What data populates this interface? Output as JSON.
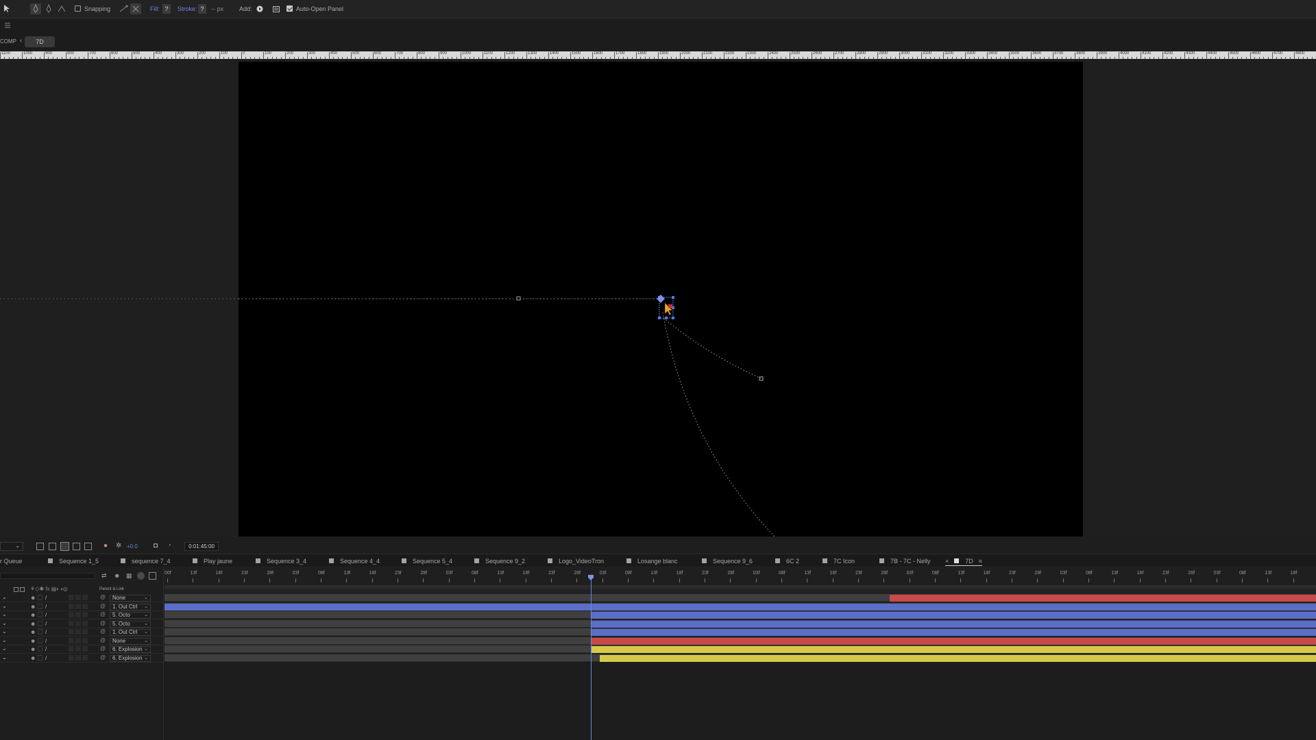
{
  "toolbar": {
    "snapping_label": "Snapping",
    "fill_label": "Fill:",
    "fill_value": "?",
    "stroke_label": "Stroke:",
    "stroke_value": "?",
    "stroke_width": "-- px",
    "add_label": "Add:",
    "auto_open_label": "Auto-Open Panel"
  },
  "comp": {
    "breadcrumb_left": "COMP",
    "active_comp": "7D"
  },
  "ruler_labels": [
    "1100",
    "1000",
    "900",
    "800",
    "700",
    "600",
    "500",
    "400",
    "300",
    "200",
    "100",
    "0",
    "100",
    "200",
    "300",
    "400",
    "500",
    "600",
    "700",
    "800",
    "900",
    "1000",
    "1100",
    "1200",
    "1300",
    "1400",
    "1500",
    "1600",
    "1700",
    "1800",
    "1900",
    "2000",
    "2100",
    "2200",
    "2300",
    "2400",
    "2500",
    "2600",
    "2700",
    "2800",
    "2900",
    "3000",
    "3100",
    "3200",
    "3300",
    "3400",
    "3500",
    "3600",
    "3700",
    "3800",
    "3900",
    "4000",
    "4100",
    "4200",
    "4300",
    "4400",
    "4500",
    "4600",
    "4700",
    "4800"
  ],
  "viewer": {
    "exposure_value": "+0.0",
    "timecode": "0:01:45:00"
  },
  "timeline_tabs": [
    {
      "label": "r Queue",
      "color": ""
    },
    {
      "label": "Sequence 1_5",
      "color": "#a8a29a"
    },
    {
      "label": "sequence 7_4",
      "color": "#a8a29a"
    },
    {
      "label": "Play jaune",
      "color": "#a8a29a"
    },
    {
      "label": "Sequence 3_4",
      "color": "#a8a29a"
    },
    {
      "label": "Sequence 4_4",
      "color": "#a8a29a"
    },
    {
      "label": "Sequence 5_4",
      "color": "#a8a29a"
    },
    {
      "label": "Sequence 9_2",
      "color": "#a8a29a"
    },
    {
      "label": "Logo_VideoTron",
      "color": "#a8a29a"
    },
    {
      "label": "Losange blanc",
      "color": "#a8a29a"
    },
    {
      "label": "Sequence 9_6",
      "color": "#a8a29a"
    },
    {
      "label": "6C 2",
      "color": "#a8a29a"
    },
    {
      "label": "7C Icon",
      "color": "#a8a29a"
    },
    {
      "label": "7B - 7C - Nelly",
      "color": "#a8a29a"
    },
    {
      "label": "7D",
      "color": "#e0e0e0"
    }
  ],
  "timeline": {
    "parent_header": "Parent & Link",
    "time_labels": [
      "00f",
      "13f",
      "18f",
      "23f",
      "28f",
      "03f",
      "08f",
      "13f",
      "18f",
      "23f",
      "28f",
      "03f",
      "08f",
      "13f",
      "18f",
      "23f",
      "28f",
      "03f",
      "08f",
      "13f",
      "18f",
      "23f",
      "28f",
      "03f",
      "08f",
      "13f",
      "18f",
      "23f",
      "28f",
      "03f",
      "08f",
      "13f",
      "18f",
      "23f",
      "28f",
      "03f",
      "08f",
      "13f",
      "18f",
      "23f",
      "28f",
      "03f",
      "08f",
      "13f",
      "18f"
    ],
    "layers": [
      {
        "parent": "None",
        "bar_color": "#c94a4a",
        "bar_start": 0.63,
        "bar_end": 1.0
      },
      {
        "parent": "1. Out Ctrl",
        "bar_color": "#5b6fc9",
        "bar_start": 0.0,
        "bar_end": 1.0
      },
      {
        "parent": "5. Octo",
        "bar_color": "#5b6fc9",
        "bar_start": 0.37,
        "bar_end": 1.0
      },
      {
        "parent": "5. Octo",
        "bar_color": "#5b6fc9",
        "bar_start": 0.37,
        "bar_end": 1.0
      },
      {
        "parent": "1. Out Ctrl",
        "bar_color": "#5b6fc9",
        "bar_start": 0.37,
        "bar_end": 1.0
      },
      {
        "parent": "None",
        "bar_color": "#c94a4a",
        "bar_start": 0.37,
        "bar_end": 1.0
      },
      {
        "parent": "6. Explosion",
        "bar_color": "#d6c94a",
        "bar_start": 0.37,
        "bar_end": 1.0
      },
      {
        "parent": "6. Explosion",
        "bar_color": "#d6c94a",
        "bar_start": 0.378,
        "bar_end": 1.0
      }
    ],
    "playhead": 0.37
  }
}
